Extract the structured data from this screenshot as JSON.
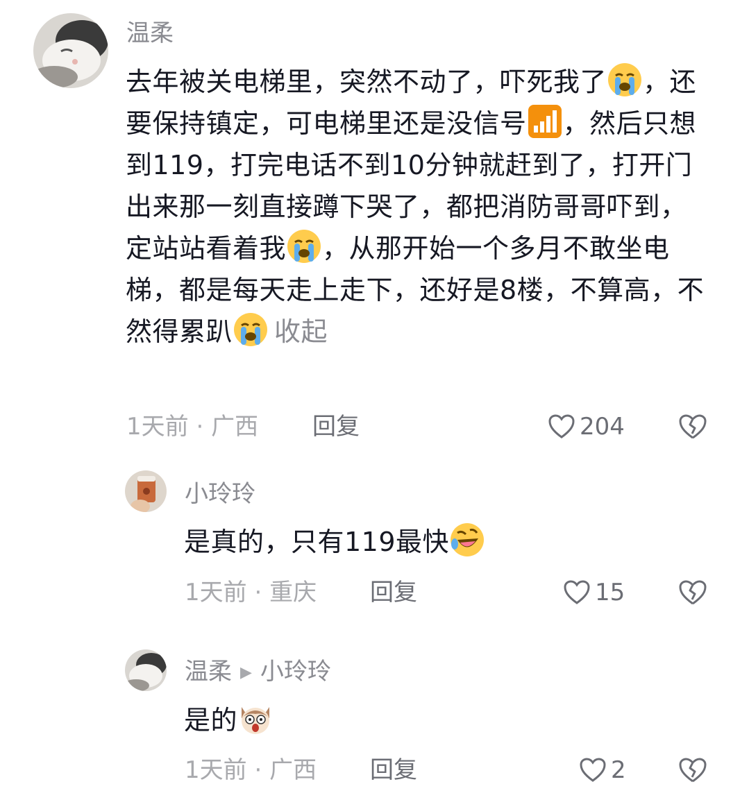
{
  "comments": [
    {
      "author": "温柔",
      "segments": {
        "s1": "去年被关电梯里，突然不动了，吓死我了",
        "s2": "，还要保持镇定，可电梯里还是没信号",
        "s3": "，然后只想到119，打完电话不到10分钟就赶到了，打开门出来那一刻直接蹲下哭了，都把消防哥哥吓到，定站站看着我",
        "s4": "，从那开始一个多月不敢坐电梯，都是每天走上走下，还好是8楼，不算高，不然得累趴"
      },
      "collapse_label": "收起",
      "time": "1天前",
      "location": "广西",
      "separator": "·",
      "reply_label": "回复",
      "likes": "204"
    },
    {
      "author": "小玲玲",
      "text": "是真的，只有119最快",
      "time": "1天前",
      "location": "重庆",
      "separator": "·",
      "reply_label": "回复",
      "likes": "15"
    },
    {
      "author": "温柔",
      "reply_to": "小玲玲",
      "text": "是的",
      "time": "1天前",
      "location": "广西",
      "separator": "·",
      "reply_label": "回复",
      "likes": "2"
    }
  ],
  "icons": {
    "crying": "loudly-crying-face-icon",
    "signal": "signal-bars-icon",
    "laughing": "rolling-laughing-face-icon",
    "shocked_dog": "shocked-dog-face-icon",
    "like": "heart-outline-icon",
    "dislike": "broken-heart-icon",
    "reply_arrow": "triangle-right-icon"
  },
  "colors": {
    "text": "#161823",
    "name": "#8a8b91",
    "meta": "#a8a9ad",
    "action": "#6b6d74"
  }
}
